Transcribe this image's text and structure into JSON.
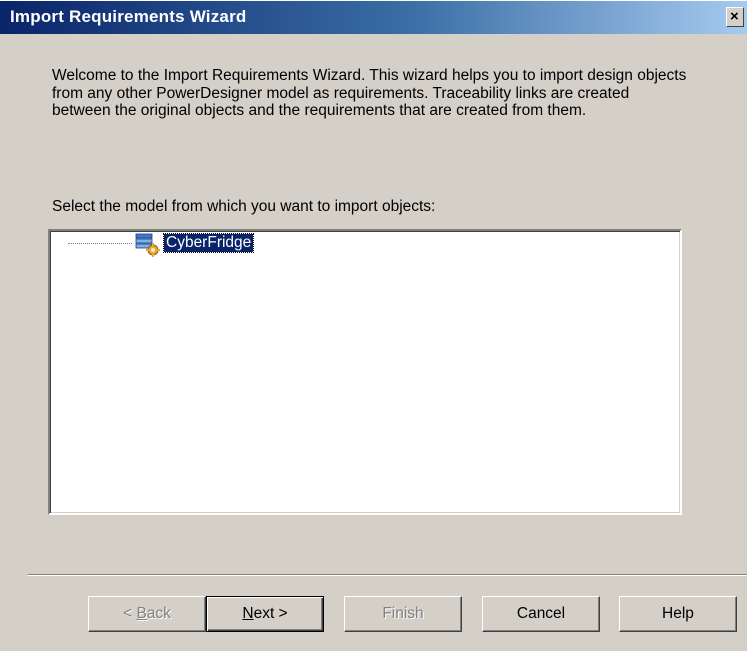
{
  "window": {
    "title": "Import Requirements Wizard",
    "close_glyph": "×"
  },
  "intro": {
    "text": "Welcome to the Import Requirements Wizard. This wizard helps you to import design objects from any other PowerDesigner model as requirements. Traceability links are created between the original objects and the requirements that are created from them."
  },
  "selection": {
    "label": "Select the model from which you want to import objects:",
    "tree": {
      "items": [
        {
          "label": "CyberFridge",
          "icon": "model-icon",
          "selected": true
        }
      ]
    }
  },
  "buttons": {
    "back": {
      "prefix": "< ",
      "accel": "B",
      "rest": "ack",
      "enabled": false
    },
    "next": {
      "accel": "N",
      "rest": "ext >",
      "enabled": true
    },
    "finish": {
      "label": "Finish",
      "enabled": false
    },
    "cancel": {
      "label": "Cancel",
      "enabled": true
    },
    "help": {
      "label": "Help",
      "enabled": true
    }
  },
  "colors": {
    "dialog_bg": "#d4d0c8",
    "title_start": "#0a246a",
    "title_end": "#a6caf0",
    "selection_bg": "#0a246a"
  }
}
